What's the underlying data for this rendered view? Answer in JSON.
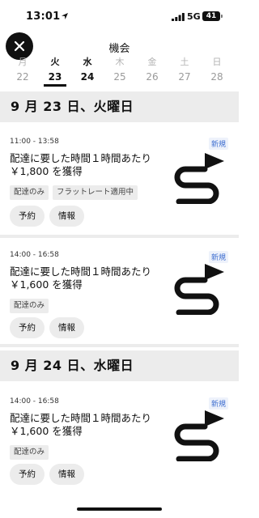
{
  "status_bar": {
    "time": "13:01",
    "network": "5G",
    "battery": "41"
  },
  "header": {
    "title": "機会"
  },
  "days": [
    {
      "label": "月",
      "num": "22"
    },
    {
      "label": "火",
      "num": "23"
    },
    {
      "label": "水",
      "num": "24"
    },
    {
      "label": "木",
      "num": "25"
    },
    {
      "label": "金",
      "num": "26"
    },
    {
      "label": "土",
      "num": "27"
    },
    {
      "label": "日",
      "num": "28"
    }
  ],
  "sections": [
    {
      "date": "9 月 23 日、火曜日"
    },
    {
      "date": "9 月 24 日、水曜日"
    }
  ],
  "cards": [
    {
      "time": "11:00 - 13:58",
      "badge": "新規",
      "title_line1": "配達に要した時間１時間あたり",
      "title_line2": "￥1,800 を獲得",
      "tags": [
        "配達のみ",
        "フラットレート適用中"
      ],
      "reserve_label": "予約",
      "info_label": "情報"
    },
    {
      "time": "14:00 - 16:58",
      "badge": "新規",
      "title_line1": "配達に要した時間１時間あたり",
      "title_line2": "￥1,600 を獲得",
      "tags": [
        "配達のみ"
      ],
      "reserve_label": "予約",
      "info_label": "情報"
    },
    {
      "time": "14:00 - 16:58",
      "badge": "新規",
      "title_line1": "配達に要した時間１時間あたり",
      "title_line2": "￥1,600 を獲得",
      "tags": [
        "配達のみ"
      ],
      "reserve_label": "予約",
      "info_label": "情報"
    }
  ]
}
